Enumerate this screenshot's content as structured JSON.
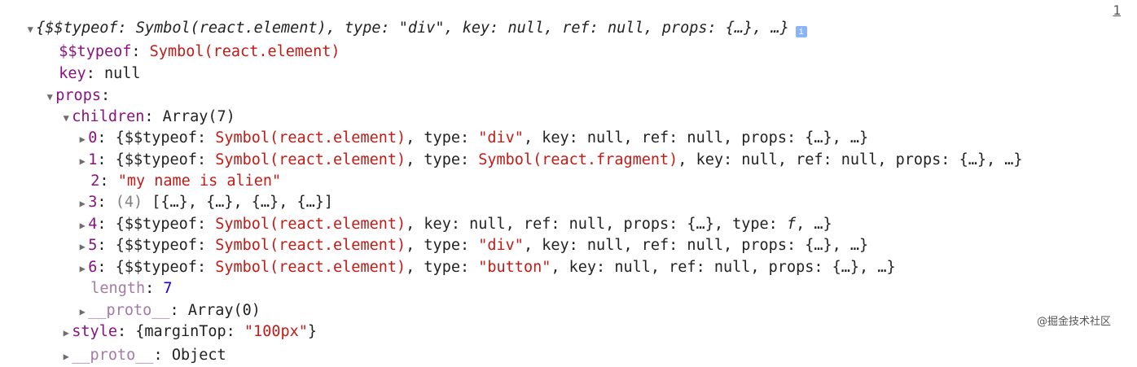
{
  "root": {
    "summary": "{$$typeof: Symbol(react.element), type: \"div\", key: null, ref: null, props: {…}, …}",
    "info_badge": "i",
    "line_link": "1"
  },
  "typeof_row": {
    "key": "$$typeof",
    "value": "Symbol(react.element)"
  },
  "key_row": {
    "key": "key",
    "value": "null"
  },
  "props_row": {
    "key": "props"
  },
  "children_row": {
    "key": "children",
    "value": "Array(7)"
  },
  "child0": {
    "index": "0",
    "open": "{$$typeof: ",
    "sym": "Symbol(react.element)",
    "mid": ", type: ",
    "type": "\"div\"",
    "rest": ", key: null, ref: null, props: {…}, …}"
  },
  "child1": {
    "index": "1",
    "open": "{$$typeof: ",
    "sym": "Symbol(react.element)",
    "mid": ", type: ",
    "type": "Symbol(react.fragment)",
    "rest": ", key: null, ref: null, props: {…}, …}"
  },
  "child2": {
    "index": "2",
    "value": "\"my name is alien\""
  },
  "child3": {
    "index": "3",
    "count": "(4)",
    "value": "[{…}, {…}, {…}, {…}]"
  },
  "child4": {
    "index": "4",
    "open": "{$$typeof: ",
    "sym": "Symbol(react.element)",
    "rest1": ", key: null, ref: null, props: {…}, type: ",
    "f": "f",
    "rest2": ", …}"
  },
  "child5": {
    "index": "5",
    "open": "{$$typeof: ",
    "sym": "Symbol(react.element)",
    "mid": ", type: ",
    "type": "\"div\"",
    "rest": ", key: null, ref: null, props: {…}, …}"
  },
  "child6": {
    "index": "6",
    "open": "{$$typeof: ",
    "sym": "Symbol(react.element)",
    "mid": ", type: ",
    "type": "\"button\"",
    "rest": ", key: null, ref: null, props: {…}, …}"
  },
  "length_row": {
    "key": "length",
    "value": "7"
  },
  "children_proto_row": {
    "key": "__proto__",
    "value": "Array(0)"
  },
  "style_row": {
    "key": "style",
    "open": "{marginTop: ",
    "value": "\"100px\"",
    "close": "}"
  },
  "props_proto_row": {
    "key": "__proto__",
    "value": "Object"
  },
  "watermark": "@掘金技术社区",
  "icons": {
    "expanded": "▼",
    "collapsed": "▶"
  }
}
